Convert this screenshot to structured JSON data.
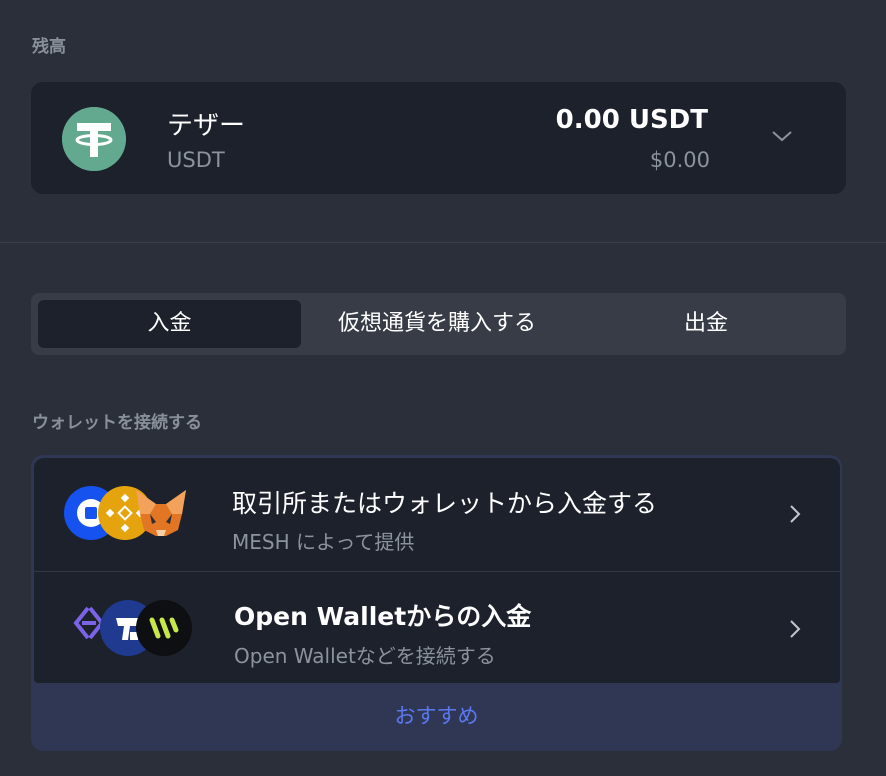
{
  "balance": {
    "section_label": "残高",
    "token": {
      "icon": "tether-icon",
      "name": "テザー",
      "symbol": "USDT",
      "amount": "0.00 USDT",
      "fiat_value": "$0.00",
      "accent_color": "#63a98f"
    }
  },
  "tabs": [
    {
      "label": "入金",
      "active": true
    },
    {
      "label": "仮想通貨を購入する",
      "active": false
    },
    {
      "label": "出金",
      "active": false
    }
  ],
  "connect_wallet": {
    "section_label": "ウォレットを接続する",
    "options": [
      {
        "title": "取引所またはウォレットから入金する",
        "subtitle": "MESH によって提供",
        "icons": [
          "coinbase-icon",
          "binance-icon",
          "metamask-icon"
        ]
      },
      {
        "title": "Open Walletからの入金",
        "subtitle": "Open Walletなどを接続する",
        "icons": [
          "ethena-icon",
          "robinhood-icon",
          "wallet-icon"
        ]
      }
    ],
    "recommended_label": "おすすめ",
    "recommended_color": "#5b78f0"
  }
}
